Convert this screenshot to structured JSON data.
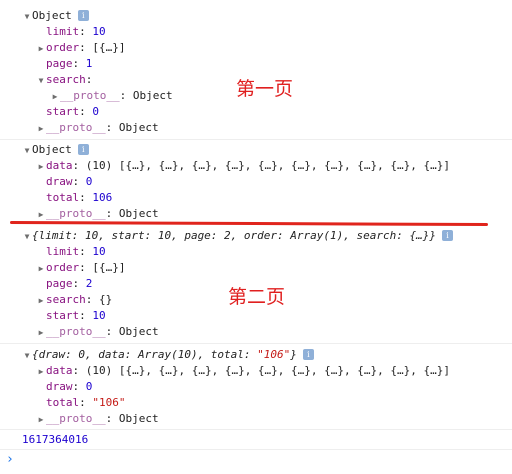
{
  "object1": {
    "header": "Object",
    "rows": [
      {
        "key": "limit",
        "value": "10"
      },
      {
        "key": "order",
        "value": "[{…}]"
      },
      {
        "key": "page",
        "value": "1"
      },
      {
        "key": "search",
        "value": ""
      },
      {
        "key": "__proto__",
        "value": "Object"
      },
      {
        "key": "start",
        "value": "0"
      },
      {
        "key": "__proto__",
        "value": "Object"
      }
    ]
  },
  "object2": {
    "header": "Object",
    "rows": [
      {
        "key": "data",
        "value": "(10) [{…}, {…}, {…}, {…}, {…}, {…}, {…}, {…}, {…}, {…}]"
      },
      {
        "key": "draw",
        "value": "0"
      },
      {
        "key": "total",
        "value": "106"
      },
      {
        "key": "__proto__",
        "value": "Object"
      }
    ]
  },
  "object3": {
    "summary": "{limit: 10, start: 10, page: 2, order: Array(1), search: {…}}",
    "rows": [
      {
        "key": "limit",
        "value": "10"
      },
      {
        "key": "order",
        "value": "[{…}]"
      },
      {
        "key": "page",
        "value": "2"
      },
      {
        "key": "search",
        "value": "{}"
      },
      {
        "key": "start",
        "value": "10"
      },
      {
        "key": "__proto__",
        "value": "Object"
      }
    ]
  },
  "object4": {
    "summary_prefix": "{draw: 0, data: Array(10), total: ",
    "summary_total": "\"106\"",
    "summary_suffix": "}",
    "rows": [
      {
        "key": "data",
        "value": "(10) [{…}, {…}, {…}, {…}, {…}, {…}, {…}, {…}, {…}, {…}]"
      },
      {
        "key": "draw",
        "value": "0"
      },
      {
        "key": "total",
        "value": "\"106\""
      },
      {
        "key": "__proto__",
        "value": "Object"
      }
    ]
  },
  "timestamp": "1617364016",
  "annotations": {
    "page1": "第一页",
    "page2": "第二页"
  },
  "prompt_symbol": "›",
  "info_icon": "i",
  "colors": {
    "key": "#881280",
    "number": "#1c00cf",
    "string": "#c41a16",
    "annotation": "#e02020",
    "timestamp": "#1a73e8"
  }
}
